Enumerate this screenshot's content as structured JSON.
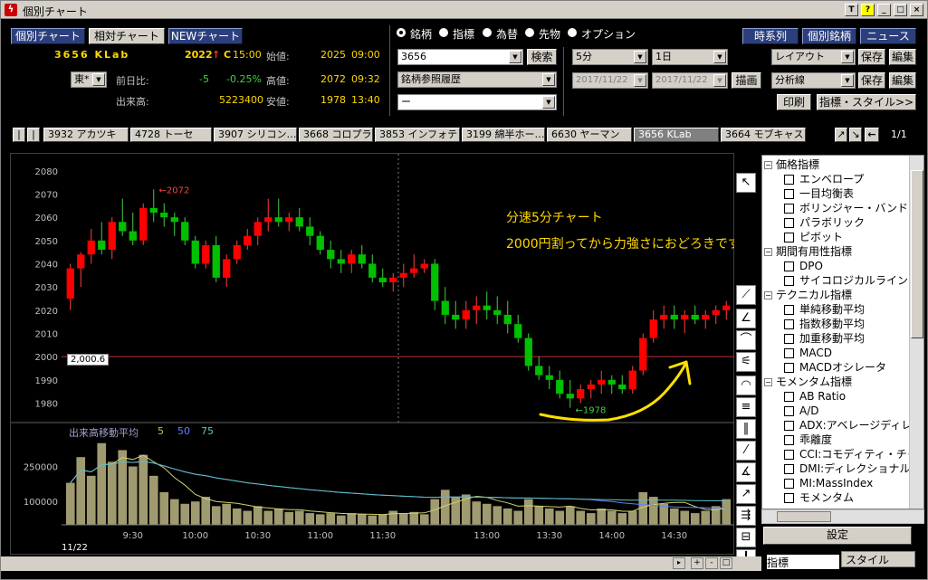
{
  "window": {
    "title": "個別チャート",
    "buttons": [
      "T",
      "?",
      "_",
      "□",
      "×"
    ]
  },
  "nav": {
    "tabs": [
      "個別チャート",
      "相対チャート",
      "NEWチャート"
    ],
    "right_buttons": [
      "時系列",
      "個別銘柄",
      "ニュース"
    ]
  },
  "quote": {
    "code_name": "3656 KLab",
    "market": "東*",
    "price": "2022",
    "arrow": "↑",
    "mark": "C",
    "time": "15:00",
    "open_label": "始値:",
    "open_value": "2025",
    "open_time": "09:00",
    "change_label": "前日比:",
    "change_value": "-5",
    "change_pct": "-0.25%",
    "high_label": "高値:",
    "high_value": "2072",
    "high_time": "09:32",
    "volume_label": "出来高:",
    "volume_value": "5223400",
    "low_label": "安値:",
    "low_value": "1978",
    "low_time": "13:40"
  },
  "asset_type": {
    "options": [
      "銘柄",
      "指標",
      "為替",
      "先物",
      "オプション"
    ],
    "selected": "銘柄"
  },
  "search": {
    "value": "3656",
    "button": "検索",
    "history": "銘柄参照履歴",
    "blank": "ー"
  },
  "period": {
    "interval": "5分",
    "span": "1日",
    "from": "2017/11/22",
    "to": "2017/11/22",
    "draw_button": "描画"
  },
  "layout": {
    "layout_label": "レイアウト",
    "analysis_label": "分析線",
    "save": "保存",
    "edit": "編集",
    "print": "印刷",
    "indicator_style": "指標・スタイル>>"
  },
  "stock_tabs": {
    "items": [
      "3932 アカツキ",
      "4728 トーセ",
      "3907 シリコン…",
      "3668 コロプラ",
      "3853 インフォテリ",
      "3199 綿半ホー…",
      "6630 ヤーマン",
      "3656 KLab",
      "3664 モブキャス"
    ],
    "active": "3656 KLab",
    "page": "1/1"
  },
  "chart_data": {
    "type": "candlestick",
    "interval": "5分",
    "y_ticks": [
      1980,
      1990,
      2000,
      2010,
      2020,
      2030,
      2040,
      2050,
      2060,
      2070,
      2080
    ],
    "ylim": [
      1972,
      2085
    ],
    "x_ticks": [
      "9:30",
      "10:00",
      "10:30",
      "11:00",
      "11:30",
      "13:00",
      "13:30",
      "14:00",
      "14:30"
    ],
    "date_label": "11/22",
    "high_marker": "←2072",
    "low_marker": "←1978",
    "price_line": "2,000.6",
    "annotation_line1": "分速5分チャート",
    "annotation_line2": "2000円割ってから力強さにおどろきです。",
    "volume_title": "出来高移動平均",
    "volume_ma": [
      "5",
      "50",
      "75"
    ],
    "volume_ticks": [
      "250000",
      "100000"
    ],
    "candles": [
      [
        2025,
        2040,
        2020,
        2038
      ],
      [
        2038,
        2045,
        2030,
        2044
      ],
      [
        2044,
        2055,
        2040,
        2050
      ],
      [
        2050,
        2058,
        2044,
        2046
      ],
      [
        2046,
        2060,
        2042,
        2058
      ],
      [
        2058,
        2068,
        2052,
        2054
      ],
      [
        2054,
        2062,
        2048,
        2050
      ],
      [
        2050,
        2066,
        2048,
        2064
      ],
      [
        2064,
        2072,
        2058,
        2062
      ],
      [
        2062,
        2066,
        2056,
        2060
      ],
      [
        2060,
        2062,
        2052,
        2058
      ],
      [
        2058,
        2060,
        2048,
        2050
      ],
      [
        2050,
        2052,
        2038,
        2040
      ],
      [
        2040,
        2050,
        2038,
        2048
      ],
      [
        2048,
        2052,
        2032,
        2034
      ],
      [
        2034,
        2044,
        2030,
        2042
      ],
      [
        2042,
        2050,
        2040,
        2048
      ],
      [
        2048,
        2055,
        2046,
        2052
      ],
      [
        2052,
        2060,
        2048,
        2058
      ],
      [
        2058,
        2068,
        2054,
        2060
      ],
      [
        2060,
        2068,
        2056,
        2058
      ],
      [
        2058,
        2062,
        2054,
        2060
      ],
      [
        2060,
        2064,
        2054,
        2056
      ],
      [
        2056,
        2060,
        2048,
        2052
      ],
      [
        2052,
        2054,
        2044,
        2046
      ],
      [
        2046,
        2050,
        2038,
        2042
      ],
      [
        2042,
        2046,
        2036,
        2040
      ],
      [
        2040,
        2046,
        2036,
        2044
      ],
      [
        2044,
        2048,
        2038,
        2040
      ],
      [
        2040,
        2044,
        2032,
        2034
      ],
      [
        2034,
        2038,
        2030,
        2032
      ],
      [
        2032,
        2036,
        2028,
        2034
      ],
      [
        2034,
        2040,
        2030,
        2036
      ],
      [
        2036,
        2044,
        2034,
        2038
      ],
      [
        2038,
        2042,
        2036,
        2040
      ],
      [
        2040,
        2042,
        2020,
        2024
      ],
      [
        2024,
        2030,
        2014,
        2018
      ],
      [
        2018,
        2024,
        2012,
        2016
      ],
      [
        2016,
        2024,
        2012,
        2020
      ],
      [
        2020,
        2026,
        2014,
        2022
      ],
      [
        2022,
        2028,
        2016,
        2020
      ],
      [
        2020,
        2026,
        2014,
        2018
      ],
      [
        2018,
        2024,
        2010,
        2014
      ],
      [
        2014,
        2018,
        2006,
        2008
      ],
      [
        2008,
        2010,
        1994,
        1996
      ],
      [
        1996,
        2000,
        1990,
        1992
      ],
      [
        1992,
        1996,
        1986,
        1990
      ],
      [
        1990,
        1994,
        1982,
        1984
      ],
      [
        1984,
        1990,
        1978,
        1982
      ],
      [
        1982,
        1988,
        1980,
        1986
      ],
      [
        1986,
        1990,
        1982,
        1988
      ],
      [
        1988,
        1994,
        1984,
        1990
      ],
      [
        1990,
        1992,
        1984,
        1988
      ],
      [
        1988,
        1992,
        1984,
        1986
      ],
      [
        1986,
        1996,
        1984,
        1994
      ],
      [
        1994,
        2010,
        1992,
        2008
      ],
      [
        2008,
        2020,
        2006,
        2016
      ],
      [
        2016,
        2022,
        2012,
        2018
      ],
      [
        2018,
        2022,
        2012,
        2016
      ],
      [
        2016,
        2020,
        2010,
        2018
      ],
      [
        2018,
        2022,
        2014,
        2016
      ],
      [
        2016,
        2020,
        2012,
        2018
      ],
      [
        2018,
        2022,
        2014,
        2020
      ],
      [
        2020,
        2024,
        2016,
        2022
      ]
    ],
    "volumes": [
      180000,
      290000,
      210000,
      350000,
      270000,
      320000,
      250000,
      300000,
      210000,
      140000,
      110000,
      90000,
      100000,
      120000,
      80000,
      90000,
      70000,
      60000,
      80000,
      60000,
      70000,
      55000,
      60000,
      50000,
      45000,
      50000,
      40000,
      50000,
      45000,
      40000,
      45000,
      60000,
      50000,
      55000,
      45000,
      110000,
      150000,
      120000,
      130000,
      100000,
      90000,
      80000,
      70000,
      60000,
      110000,
      80000,
      70000,
      60000,
      80000,
      60000,
      50000,
      70000,
      60000,
      50000,
      60000,
      140000,
      120000,
      90000,
      70000,
      60000,
      50000,
      60000,
      80000,
      110000
    ]
  },
  "indicator_tree": [
    {
      "group": "価格指標",
      "items": [
        "エンベロープ",
        "一目均衡表",
        "ボリンジャー・バンド",
        "パラボリック",
        "ピボット"
      ]
    },
    {
      "group": "期間有用性指標",
      "items": [
        "DPO",
        "サイコロジカルライン"
      ]
    },
    {
      "group": "テクニカル指標",
      "items": [
        "単純移動平均",
        "指数移動平均",
        "加重移動平均",
        "MACD",
        "MACDオシレータ"
      ]
    },
    {
      "group": "モメンタム指標",
      "items": [
        "AB Ratio",
        "A/D",
        "ADX:アベレージディレ",
        "乖離度",
        "CCI:コモディティ・チャ",
        "DMI:ディレクショナル",
        "MI:MassIndex",
        "モメンタム"
      ]
    }
  ],
  "panel": {
    "settings": "設定",
    "tab_indicator": "指標",
    "tab_style": "スタイル"
  },
  "colors": {
    "up": "#ff0000",
    "down": "#00c000",
    "bg": "#000000",
    "accent": "#ffd800"
  }
}
